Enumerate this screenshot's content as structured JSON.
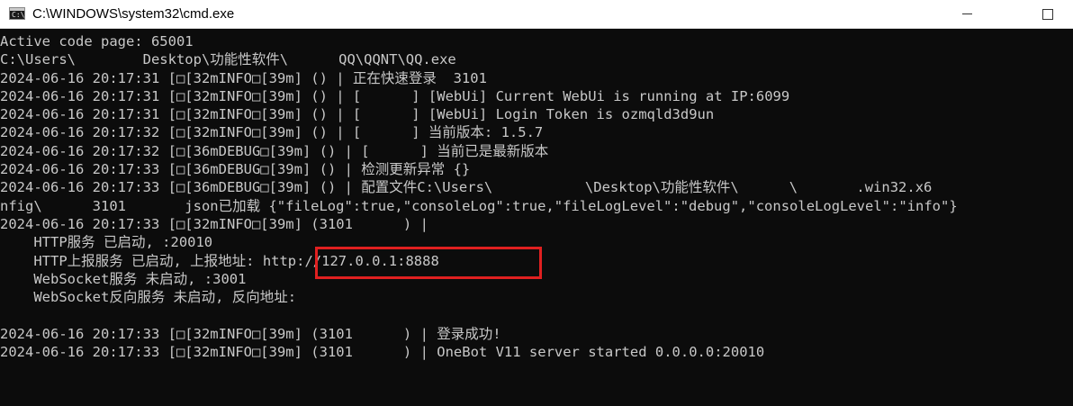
{
  "window": {
    "title": "C:\\WINDOWS\\system32\\cmd.exe",
    "icon_text": "C:\\",
    "controls": [
      "minimize-icon",
      "maximize-icon"
    ]
  },
  "console": {
    "lines": [
      "Active code page: 65001",
      "C:\\Users\\        Desktop\\功能性软件\\      QQ\\QQNT\\QQ.exe",
      "2024-06-16 20:17:31 [□[32mINFO□[39m] () | 正在快速登录  3101",
      "2024-06-16 20:17:31 [□[32mINFO□[39m] () | [      ] [WebUi] Current WebUi is running at IP:6099",
      "2024-06-16 20:17:31 [□[32mINFO□[39m] () | [      ] [WebUi] Login Token is ozmqld3d9un",
      "2024-06-16 20:17:32 [□[32mINFO□[39m] () | [      ] 当前版本: 1.5.7",
      "2024-06-16 20:17:32 [□[36mDEBUG□[39m] () | [      ] 当前已是最新版本",
      "2024-06-16 20:17:33 [□[36mDEBUG□[39m] () | 检测更新异常 {}",
      "2024-06-16 20:17:33 [□[36mDEBUG□[39m] () | 配置文件C:\\Users\\           \\Desktop\\功能性软件\\      \\       .win32.x6",
      "nfig\\      3101       json已加载 {\"fileLog\":true,\"consoleLog\":true,\"fileLogLevel\":\"debug\",\"consoleLogLevel\":\"info\"}",
      "2024-06-16 20:17:33 [□[32mINFO□[39m] (3101      ) |",
      "    HTTP服务 已启动, :20010",
      "    HTTP上报服务 已启动, 上报地址: http://127.0.0.1:8888",
      "    WebSocket服务 未启动, :3001",
      "    WebSocket反向服务 未启动, 反向地址:",
      "",
      "2024-06-16 20:17:33 [□[32mINFO□[39m] (3101      ) | 登录成功!",
      "2024-06-16 20:17:33 [□[32mINFO□[39m] (3101      ) | OneBot V11 server started 0.0.0.0:20010"
    ]
  },
  "highlight": {
    "text": "http://127.0.0.1:8888",
    "color": "#e02020"
  },
  "colors": {
    "background": "#0c0c0c",
    "text": "#c8c8c8",
    "titlebar": "#ffffff"
  }
}
